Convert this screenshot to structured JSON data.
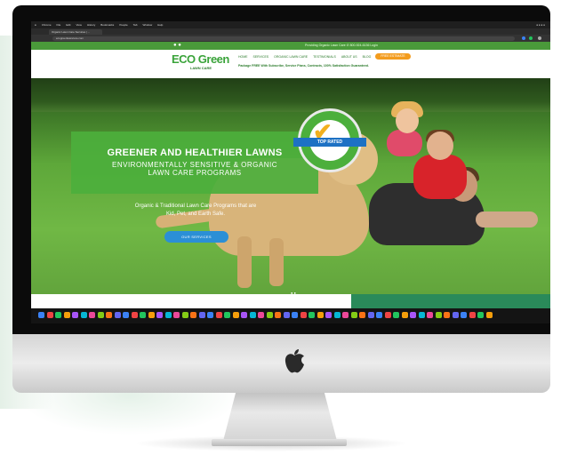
{
  "browser": {
    "menu_items": [
      "Chrome",
      "File",
      "Edit",
      "View",
      "History",
      "Bookmarks",
      "People",
      "Tab",
      "Window",
      "Help"
    ],
    "tab_title": "Organic Lawn Care Services | ...",
    "url": "ecogreenlawncare.com"
  },
  "site": {
    "util_text": "Providing Organic Lawn Care    ✆ 800-924-6136   Login",
    "logo_main": "ECO Green",
    "logo_sub": "LAWN CARE",
    "nav": [
      "HOME",
      "SERVICES",
      "ORGANIC LAWN CARE",
      "TESTIMONIALS",
      "ABOUT US",
      "BLOG"
    ],
    "nav_cta": "FREE ESTIMATE",
    "promo": "Package FREE With Subscribe, Service Plans, Contracts, 100% Satisfaction Guaranteed."
  },
  "hero": {
    "title": "GREENER AND HEALTHIER LAWNS",
    "subtitle_line1": "ENVIRONMENTALLY SENSITIVE & ORGANIC",
    "subtitle_line2": "LAWN CARE PROGRAMS",
    "body_line1": "Organic & Traditional Lawn Care Programs that are",
    "body_line2": "Kid, Pet, and Earth Safe.",
    "button": "OUR SERVICES"
  },
  "badge": {
    "ribbon": "TOP RATED"
  },
  "colors": {
    "brand_green": "#4caf3c",
    "cta_orange": "#f39c1e",
    "button_blue": "#2b8fd6"
  }
}
